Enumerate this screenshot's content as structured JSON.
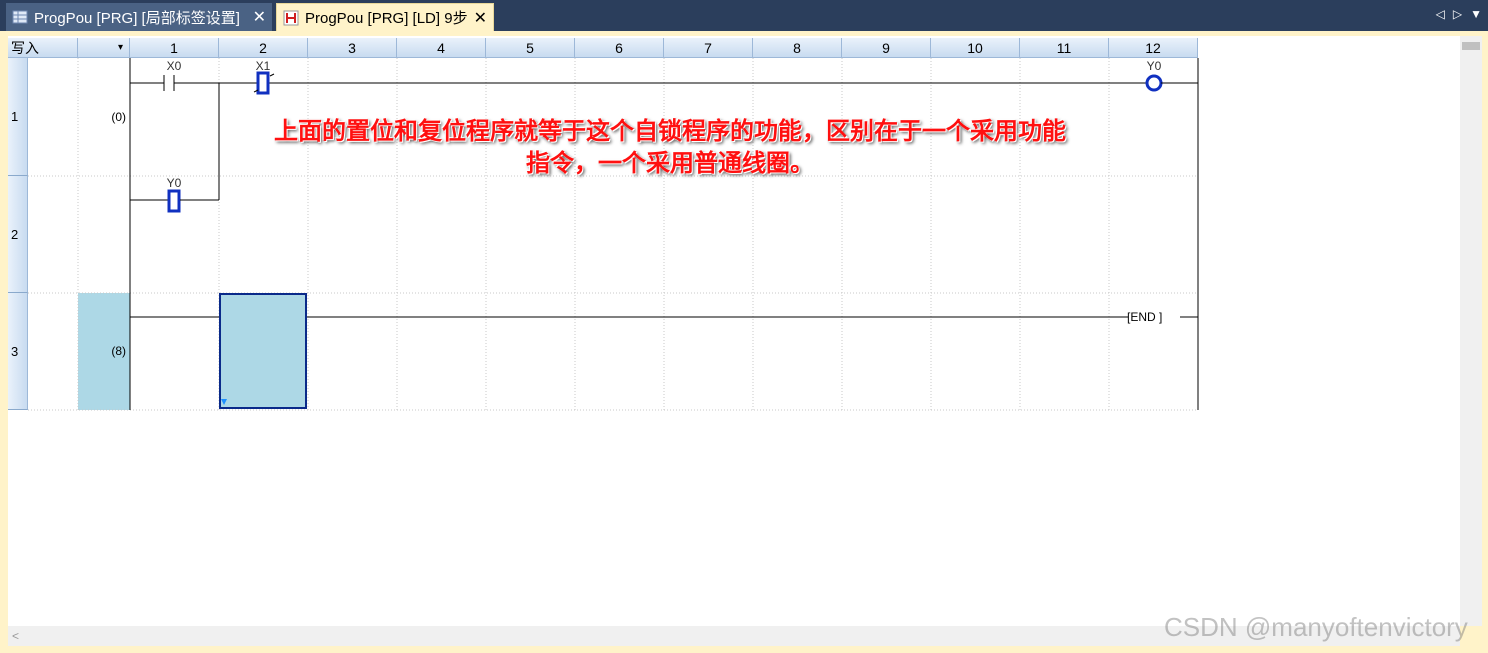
{
  "tabs": [
    {
      "title": "ProgPou [PRG] [局部标签设置]",
      "close": "✕",
      "icon": "table-icon"
    },
    {
      "title": "ProgPou [PRG] [LD] 9步",
      "close": "✕",
      "icon": "ladder-icon"
    }
  ],
  "nav": {
    "prev": "◁",
    "next": "▷",
    "menu": "▼"
  },
  "editor": {
    "mode": "写入",
    "mode_arrow": "▾",
    "columns": [
      "1",
      "2",
      "3",
      "4",
      "5",
      "6",
      "7",
      "8",
      "9",
      "10",
      "11",
      "12"
    ],
    "rows": [
      {
        "number": "1",
        "step": "(0)"
      },
      {
        "number": "2",
        "step": ""
      },
      {
        "number": "3",
        "step": "(8)"
      }
    ],
    "contacts": {
      "x0": "X0",
      "x1": "X1",
      "y0_contact": "Y0",
      "y0_coil": "Y0",
      "end": "[END  ]"
    }
  },
  "annotation": {
    "line1": "上面的置位和复位程序就等于这个自锁程序的功能，区别在于一个采用功能",
    "line2": "指令，一个采用普通线圈。"
  },
  "watermark": "CSDN @manyoftenvictory",
  "colors": {
    "accent": "#2b3e5c",
    "selection": "#add8e6",
    "annotation": "#ff1010"
  }
}
